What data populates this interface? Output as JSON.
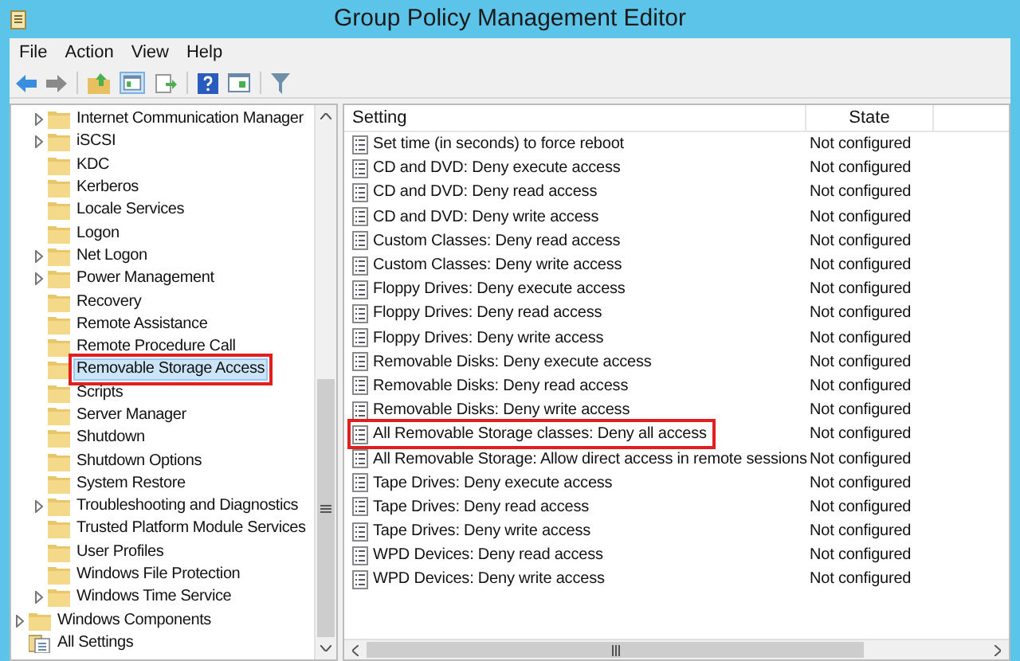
{
  "window": {
    "title": "Group Policy Management Editor"
  },
  "menu": [
    "File",
    "Action",
    "View",
    "Help"
  ],
  "tree": [
    {
      "children": [
        {
          "label": "Internet Communication Manager",
          "expandable": true,
          "selected": false,
          "highlighted": false
        },
        {
          "label": "iSCSI",
          "expandable": true,
          "selected": false,
          "highlighted": false
        },
        {
          "label": "KDC",
          "expandable": false,
          "selected": false,
          "highlighted": false
        },
        {
          "label": "Kerberos",
          "expandable": false,
          "selected": false,
          "highlighted": false
        },
        {
          "label": "Locale Services",
          "expandable": false,
          "selected": false,
          "highlighted": false
        },
        {
          "label": "Logon",
          "expandable": false,
          "selected": false,
          "highlighted": false
        },
        {
          "label": "Net Logon",
          "expandable": true,
          "selected": false,
          "highlighted": false
        },
        {
          "label": "Power Management",
          "expandable": true,
          "selected": false,
          "highlighted": false
        },
        {
          "label": "Recovery",
          "expandable": false,
          "selected": false,
          "highlighted": false
        },
        {
          "label": "Remote Assistance",
          "expandable": false,
          "selected": false,
          "highlighted": false
        },
        {
          "label": "Remote Procedure Call",
          "expandable": false,
          "selected": false,
          "highlighted": false
        },
        {
          "label": "Removable Storage Access",
          "expandable": false,
          "selected": true,
          "highlighted": true
        },
        {
          "label": "Scripts",
          "expandable": false,
          "selected": false,
          "highlighted": false
        },
        {
          "label": "Server Manager",
          "expandable": false,
          "selected": false,
          "highlighted": false
        },
        {
          "label": "Shutdown",
          "expandable": false,
          "selected": false,
          "highlighted": false
        },
        {
          "label": "Shutdown Options",
          "expandable": false,
          "selected": false,
          "highlighted": false
        },
        {
          "label": "System Restore",
          "expandable": false,
          "selected": false,
          "highlighted": false
        },
        {
          "label": "Troubleshooting and Diagnostics",
          "expandable": true,
          "selected": false,
          "highlighted": false
        },
        {
          "label": "Trusted Platform Module Services",
          "expandable": false,
          "selected": false,
          "highlighted": false
        },
        {
          "label": "User Profiles",
          "expandable": false,
          "selected": false,
          "highlighted": false
        },
        {
          "label": "Windows File Protection",
          "expandable": false,
          "selected": false,
          "highlighted": false
        },
        {
          "label": "Windows Time Service",
          "expandable": true,
          "selected": false,
          "highlighted": false
        }
      ]
    },
    {
      "label": "Windows Components",
      "kind": "folder",
      "expandable": true,
      "selected": false,
      "highlighted": false
    },
    {
      "label": "All Settings",
      "kind": "settings",
      "expandable": false,
      "selected": false,
      "highlighted": false
    }
  ],
  "table": {
    "columns": [
      "Setting",
      "State"
    ],
    "rows": [
      {
        "setting": "Set time (in seconds) to force reboot",
        "state": "Not configured",
        "highlighted": false
      },
      {
        "setting": "CD and DVD: Deny execute access",
        "state": "Not configured",
        "highlighted": false
      },
      {
        "setting": "CD and DVD: Deny read access",
        "state": "Not configured",
        "highlighted": false
      },
      {
        "setting": "CD and DVD: Deny write access",
        "state": "Not configured",
        "highlighted": false
      },
      {
        "setting": "Custom Classes: Deny read access",
        "state": "Not configured",
        "highlighted": false
      },
      {
        "setting": "Custom Classes: Deny write access",
        "state": "Not configured",
        "highlighted": false
      },
      {
        "setting": "Floppy Drives: Deny execute access",
        "state": "Not configured",
        "highlighted": false
      },
      {
        "setting": "Floppy Drives: Deny read access",
        "state": "Not configured",
        "highlighted": false
      },
      {
        "setting": "Floppy Drives: Deny write access",
        "state": "Not configured",
        "highlighted": false
      },
      {
        "setting": "Removable Disks: Deny execute access",
        "state": "Not configured",
        "highlighted": false
      },
      {
        "setting": "Removable Disks: Deny read access",
        "state": "Not configured",
        "highlighted": false
      },
      {
        "setting": "Removable Disks: Deny write access",
        "state": "Not configured",
        "highlighted": false
      },
      {
        "setting": "All Removable Storage classes: Deny all access",
        "state": "Not configured",
        "highlighted": true
      },
      {
        "setting": "All Removable Storage: Allow direct access in remote sessions",
        "state": "Not configured",
        "highlighted": false
      },
      {
        "setting": "Tape Drives: Deny execute access",
        "state": "Not configured",
        "highlighted": false
      },
      {
        "setting": "Tape Drives: Deny read access",
        "state": "Not configured",
        "highlighted": false
      },
      {
        "setting": "Tape Drives: Deny write access",
        "state": "Not configured",
        "highlighted": false
      },
      {
        "setting": "WPD Devices: Deny read access",
        "state": "Not configured",
        "highlighted": false
      },
      {
        "setting": "WPD Devices: Deny write access",
        "state": "Not configured",
        "highlighted": false
      }
    ]
  }
}
